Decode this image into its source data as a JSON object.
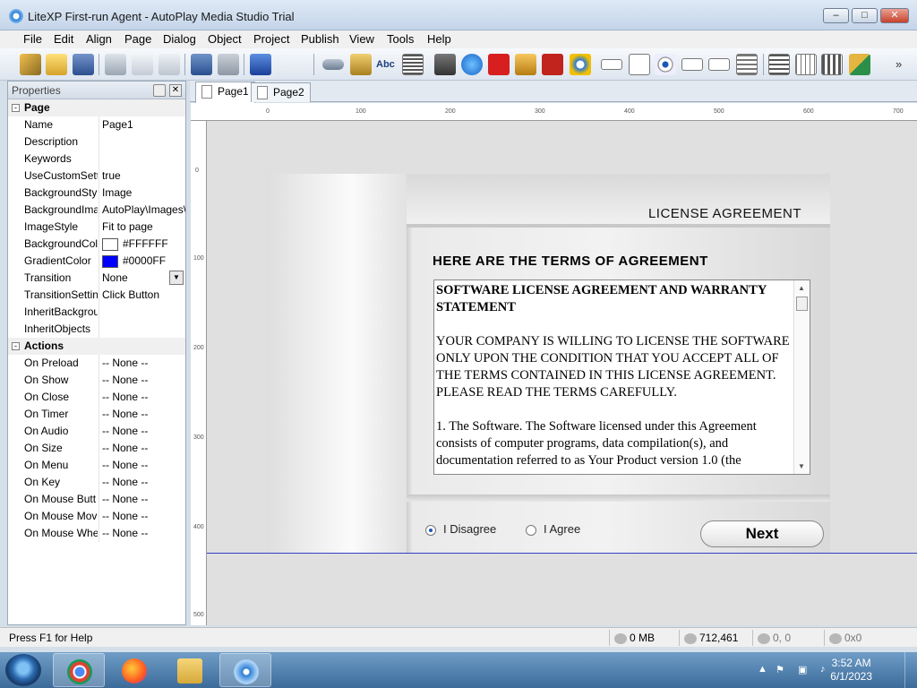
{
  "window": {
    "title": "LiteXP First-run Agent - AutoPlay Media Studio Trial",
    "controls": {
      "minimize": "–",
      "maximize": "□",
      "close": "✕"
    }
  },
  "menu": [
    "File",
    "Edit",
    "Align",
    "Page",
    "Dialog",
    "Object",
    "Project",
    "Publish",
    "View",
    "Tools",
    "Help"
  ],
  "toolbar": {
    "icons": [
      "wand-icon",
      "open-folder-icon",
      "save-icon",
      "cut-icon",
      "copy-icon",
      "paste-icon",
      "undo-icon",
      "redo-icon",
      "preview-icon",
      "button-object-icon",
      "image-object-icon",
      "label-object-icon",
      "paragraph-object-icon",
      "video-object-icon",
      "quicktime-object-icon",
      "flash-object-icon",
      "slideshow-object-icon",
      "pdf-object-icon",
      "web-object-icon",
      "input-object-icon",
      "checkbox-object-icon",
      "radio-object-icon",
      "combobox-object-icon",
      "listbox-object-icon",
      "tree-object-icon",
      "grid-object-icon",
      "progress-object-icon",
      "xbutton-object-icon"
    ],
    "label_icon_text": "Abc",
    "overflow": "»"
  },
  "properties": {
    "title": "Properties",
    "sections": [
      {
        "name": "Page",
        "toggle": "-",
        "rows": [
          {
            "name": "Name",
            "value": "Page1"
          },
          {
            "name": "Description",
            "value": ""
          },
          {
            "name": "Keywords",
            "value": ""
          },
          {
            "name": "UseCustomSett",
            "value": "true"
          },
          {
            "name": "BackgroundStyl",
            "value": "Image"
          },
          {
            "name": "BackgroundIma",
            "value": "AutoPlay\\Images\\"
          },
          {
            "name": "ImageStyle",
            "value": "Fit to page"
          },
          {
            "name": "BackgroundCol",
            "value": "#FFFFFF",
            "swatch": "#FFFFFF"
          },
          {
            "name": "GradientColor",
            "value": "#0000FF",
            "swatch": "#0000FF"
          },
          {
            "name": "Transition",
            "value": "None",
            "dropdown": true
          },
          {
            "name": "TransitionSettin",
            "value": "Click Button"
          },
          {
            "name": "InheritBackgrou",
            "value": ""
          },
          {
            "name": "InheritObjects",
            "value": ""
          }
        ]
      },
      {
        "name": "Actions",
        "toggle": "-",
        "rows": [
          {
            "name": "On Preload",
            "value": "-- None --"
          },
          {
            "name": "On Show",
            "value": "-- None --"
          },
          {
            "name": "On Close",
            "value": "-- None --"
          },
          {
            "name": "On Timer",
            "value": "-- None --"
          },
          {
            "name": "On Audio",
            "value": "-- None --"
          },
          {
            "name": "On Size",
            "value": "-- None --"
          },
          {
            "name": "On Menu",
            "value": "-- None --"
          },
          {
            "name": "On Key",
            "value": "-- None --"
          },
          {
            "name": "On Mouse Butt",
            "value": "-- None --"
          },
          {
            "name": "On Mouse Mov",
            "value": "-- None --"
          },
          {
            "name": "On Mouse Whe",
            "value": "-- None --"
          }
        ]
      }
    ]
  },
  "tabs": [
    "Page1",
    "Page2"
  ],
  "ruler": {
    "h": [
      "0",
      "100",
      "200",
      "300",
      "400",
      "500",
      "600",
      "700"
    ],
    "v": [
      "0",
      "100",
      "200",
      "300",
      "400",
      "500"
    ]
  },
  "canvas": {
    "header": "LICENSE AGREEMENT",
    "heading": "HERE ARE THE TERMS OF AGREEMENT",
    "license_title": "SOFTWARE LICENSE AGREEMENT AND WARRANTY STATEMENT",
    "license_p1": "YOUR COMPANY IS WILLING TO LICENSE THE SOFTWARE ONLY UPON THE CONDITION THAT YOU ACCEPT ALL OF THE TERMS CONTAINED IN THIS LICENSE AGREEMENT.  PLEASE READ THE TERMS CAREFULLY.",
    "license_p2": "1. The Software.  The Software licensed under this Agreement consists of computer programs, data compilation(s), and documentation referred to as Your Product version 1.0 (the",
    "radio_disagree": "I Disagree",
    "radio_agree": "I Agree",
    "selected": "I Disagree",
    "next_button": "Next"
  },
  "statusbar": {
    "help": "Press F1 for Help",
    "memory": "0 MB",
    "size": "712,461",
    "position": "0, 0",
    "dimensions": "0x0"
  },
  "taskbar": {
    "apps": [
      "chrome-icon",
      "firefox-icon",
      "file-explorer-icon",
      "autoplay-icon"
    ],
    "time": "3:52 AM",
    "date": "6/1/2023"
  },
  "colors": {
    "accent": "#3340c8",
    "gradient": "#0000FF"
  }
}
